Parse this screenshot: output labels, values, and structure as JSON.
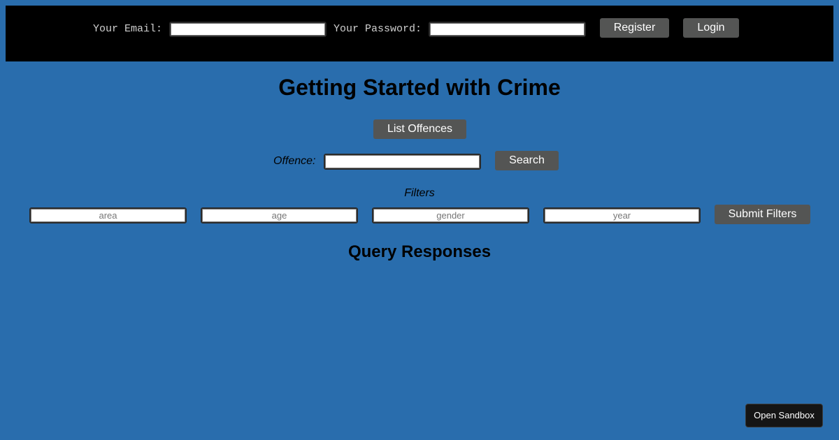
{
  "auth": {
    "email_label": "Your Email:",
    "email_value": "",
    "password_label": "Your Password:",
    "password_value": "",
    "register_label": "Register",
    "login_label": "Login"
  },
  "page": {
    "title": "Getting Started with Crime"
  },
  "offences": {
    "list_label": "List Offences",
    "search_label": "Offence:",
    "search_value": "",
    "search_button": "Search"
  },
  "filters": {
    "heading": "Filters",
    "area_placeholder": "area",
    "age_placeholder": "age",
    "gender_placeholder": "gender",
    "year_placeholder": "year",
    "submit_label": "Submit Filters"
  },
  "responses": {
    "heading": "Query Responses"
  },
  "sandbox": {
    "label": "Open Sandbox"
  },
  "colors": {
    "background": "#296dad",
    "topbar": "#000000",
    "button": "#545554",
    "sandbox_button": "#151515"
  }
}
